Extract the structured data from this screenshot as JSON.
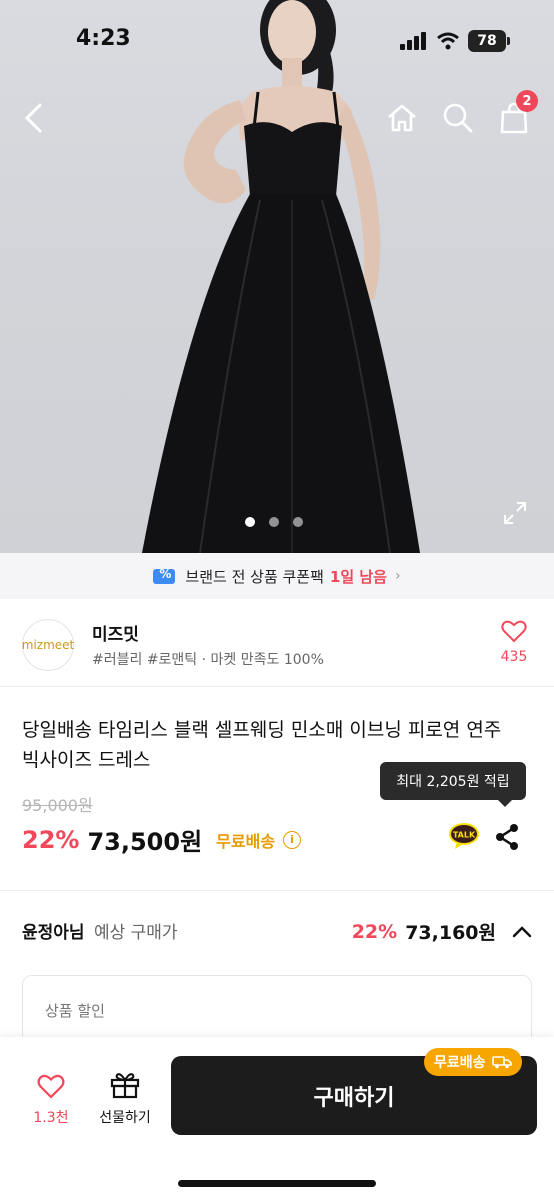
{
  "status_bar": {
    "time": "4:23",
    "battery": "78"
  },
  "header": {
    "cart_count": "2"
  },
  "gallery": {
    "image_count": 3,
    "active_index": 0
  },
  "coupon_banner": {
    "text": "브랜드 전 상품 쿠폰팩",
    "highlight": "1일 남음"
  },
  "shop": {
    "logo_text": "mizmeet",
    "name": "미즈밋",
    "tags": "#러블리 #로맨틱 · 마켓 만족도 100%",
    "like_count": "435"
  },
  "product": {
    "title": "당일배송 타임리스 블랙 셀프웨딩 민소매 이브닝 피로연 연주 빅사이즈 드레스",
    "original_price": "95,000원",
    "discount_rate": "22%",
    "price": "73,500원",
    "free_shipping": "무료배송",
    "points_tooltip": "최대 2,205원 적립"
  },
  "member_price": {
    "name": "윤정아님",
    "label": "예상 구매가",
    "discount_rate": "22%",
    "price": "73,160원"
  },
  "discount_detail": {
    "label": "상품 할인"
  },
  "bottom_bar": {
    "like_label": "1.3천",
    "gift_label": "선물하기",
    "buy_label": "구매하기",
    "shipping_badge": "무료배송"
  },
  "colors": {
    "accent": "#f0485a",
    "shipping": "#e89a00",
    "buy_button": "#1c1c1c"
  }
}
